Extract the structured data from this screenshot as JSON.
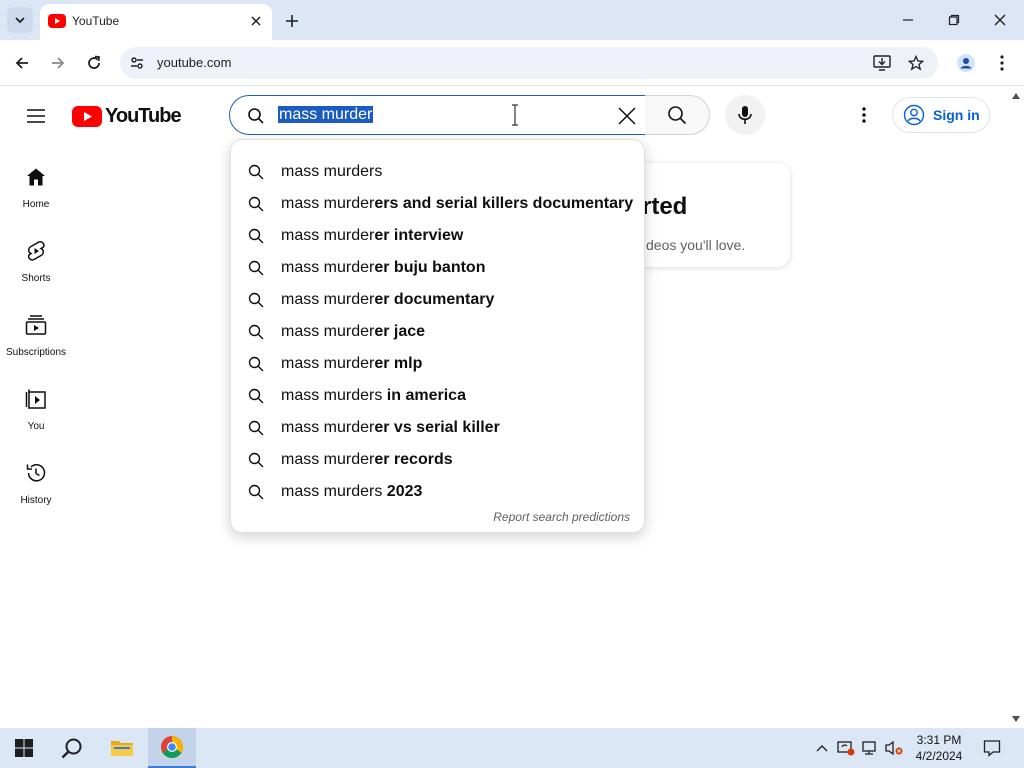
{
  "browser": {
    "tab_title": "YouTube",
    "url": "youtube.com"
  },
  "youtube": {
    "logo_text": "YouTube",
    "search_query": "mass murder",
    "sign_in_label": "Sign in",
    "sidebar": [
      {
        "label": "Home",
        "icon": "home-icon"
      },
      {
        "label": "Shorts",
        "icon": "shorts-icon"
      },
      {
        "label": "Subscriptions",
        "icon": "subscriptions-icon"
      },
      {
        "label": "You",
        "icon": "you-icon"
      },
      {
        "label": "History",
        "icon": "history-icon"
      }
    ],
    "card": {
      "title_fragment": "rted",
      "subtitle_fragment": "deos you'll love."
    },
    "suggestions": [
      {
        "prefix": "mass murders",
        "suffix": ""
      },
      {
        "prefix": "mass murder",
        "suffix": "ers and serial killers documentary"
      },
      {
        "prefix": "mass murder",
        "suffix": "er interview"
      },
      {
        "prefix": "mass murder",
        "suffix": "er buju banton"
      },
      {
        "prefix": "mass murder",
        "suffix": "er documentary"
      },
      {
        "prefix": "mass murder",
        "suffix": "er jace"
      },
      {
        "prefix": "mass murder",
        "suffix": "er mlp"
      },
      {
        "prefix": "mass murders",
        "suffix": " in america"
      },
      {
        "prefix": "mass murder",
        "suffix": "er vs serial killer"
      },
      {
        "prefix": "mass murder",
        "suffix": "er records"
      },
      {
        "prefix": "mass murders",
        "suffix": " 2023"
      }
    ],
    "report_label": "Report search predictions"
  },
  "taskbar": {
    "time": "3:31 PM",
    "date": "4/2/2024"
  },
  "colors": {
    "youtube_red": "#ff0000",
    "link_blue": "#065fd4",
    "selection_blue": "#1a5bc4",
    "chrome_frame": "#dde6f5"
  }
}
